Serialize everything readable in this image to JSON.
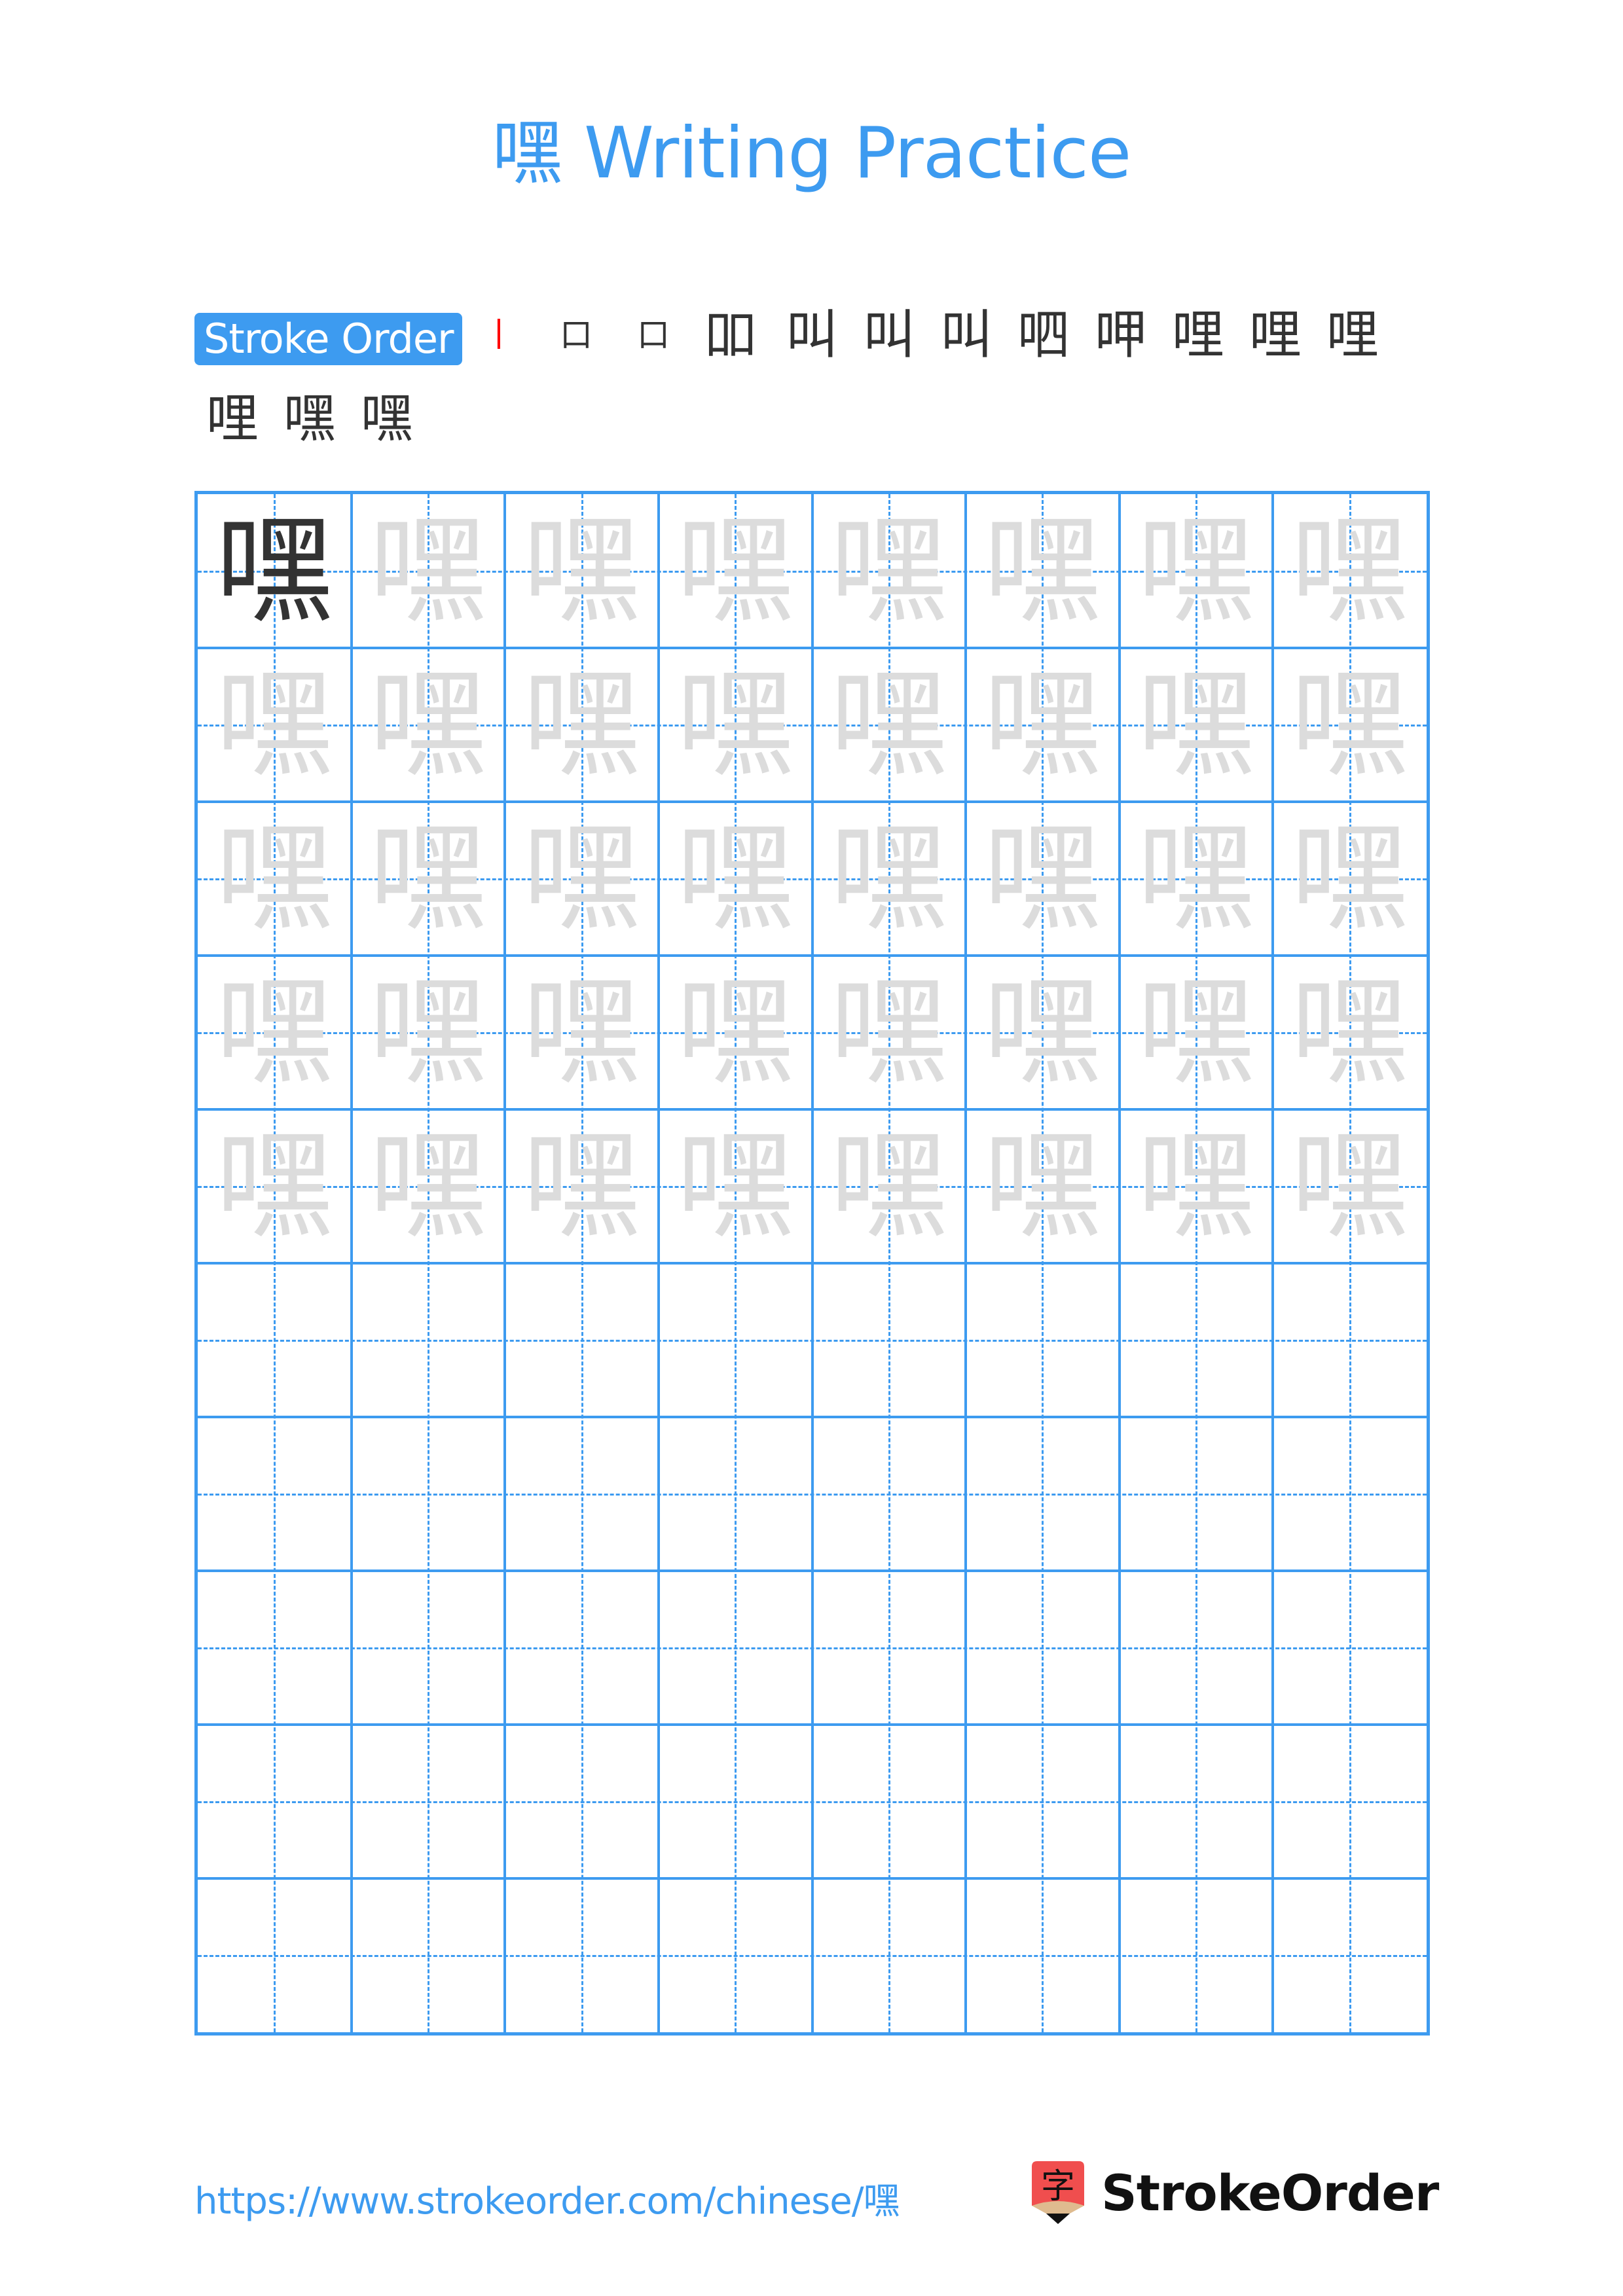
{
  "title": "嘿 Writing Practice",
  "stroke_order": {
    "label": "Stroke Order",
    "character": "嘿",
    "stroke_count": 15,
    "steps": [
      {
        "n": 1,
        "done": "",
        "current": "丨"
      },
      {
        "n": 2,
        "done": "丨",
        "current": "𠃌"
      },
      {
        "n": 3,
        "done": "口",
        "current": "一"
      },
      {
        "n": 4,
        "done": "口",
        "current": "丨"
      },
      {
        "n": 5,
        "done": "口丨",
        "current": "𠃌"
      },
      {
        "n": 6,
        "done": "口冂",
        "current": "丶"
      },
      {
        "n": 7,
        "done": "口冂丶",
        "current": "丿"
      },
      {
        "n": 8,
        "done": "口罒",
        "current": "一"
      },
      {
        "n": 9,
        "done": "口罒",
        "current": "丨"
      },
      {
        "n": 10,
        "done": "口甲",
        "current": "一"
      },
      {
        "n": 11,
        "done": "口里",
        "current": "一"
      },
      {
        "n": 12,
        "done": "哩",
        "current": "丿"
      },
      {
        "n": 13,
        "done": "哩丿",
        "current": "丶"
      },
      {
        "n": 14,
        "done": "哩丿丶",
        "current": "丶"
      },
      {
        "n": 15,
        "done": "哩灬",
        "current": "丶"
      }
    ],
    "step_glyphs": [
      "丨",
      "口",
      "口",
      "吅",
      "叫",
      "叫",
      "叫",
      "呬",
      "呷",
      "哩",
      "哩",
      "哩",
      "哩",
      "嘿",
      "嘿"
    ],
    "colors": {
      "done": "#333333",
      "current": "#ff0000"
    }
  },
  "grid": {
    "rows": 10,
    "cols": 8,
    "character": "嘿",
    "model_cells": 1,
    "trace_rows": 5,
    "empty_rows": 5,
    "colors": {
      "line": "#3d9bf0",
      "model": "#333333",
      "trace": "#dcdcdc"
    }
  },
  "footer": {
    "url": "https://www.strokeorder.com/chinese/嘿",
    "logo_glyph": "字",
    "logo_text": "StrokeOrder"
  },
  "colors": {
    "accent": "#3d9bf0",
    "logo_red": "#f04e4e",
    "logo_tan": "#dfbb8f"
  }
}
